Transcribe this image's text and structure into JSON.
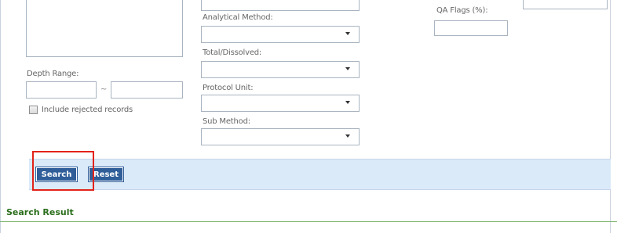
{
  "form": {
    "analytical_method": {
      "label": "Analytical Method:",
      "value": ""
    },
    "total_dissolved": {
      "label": "Total/Dissolved:",
      "value": ""
    },
    "protocol_unit": {
      "label": "Protocol Unit:",
      "value": ""
    },
    "sub_method": {
      "label": "Sub Method:",
      "value": ""
    },
    "depth_range": {
      "label": "Depth Range:",
      "separator": "~",
      "from": "",
      "to": ""
    },
    "include_rejected": {
      "label": "Include rejected records",
      "checked": false
    },
    "qa_flags": {
      "label": "QA Flags (%):",
      "value": ""
    }
  },
  "actions": {
    "search_label": "Search",
    "reset_label": "Reset"
  },
  "results": {
    "title": "Search Result"
  },
  "colors": {
    "toolbar_bg": "#dbeaf9",
    "button_bg": "#2f5e99",
    "highlight": "#e2231a",
    "result_title": "#2a6e1c"
  }
}
